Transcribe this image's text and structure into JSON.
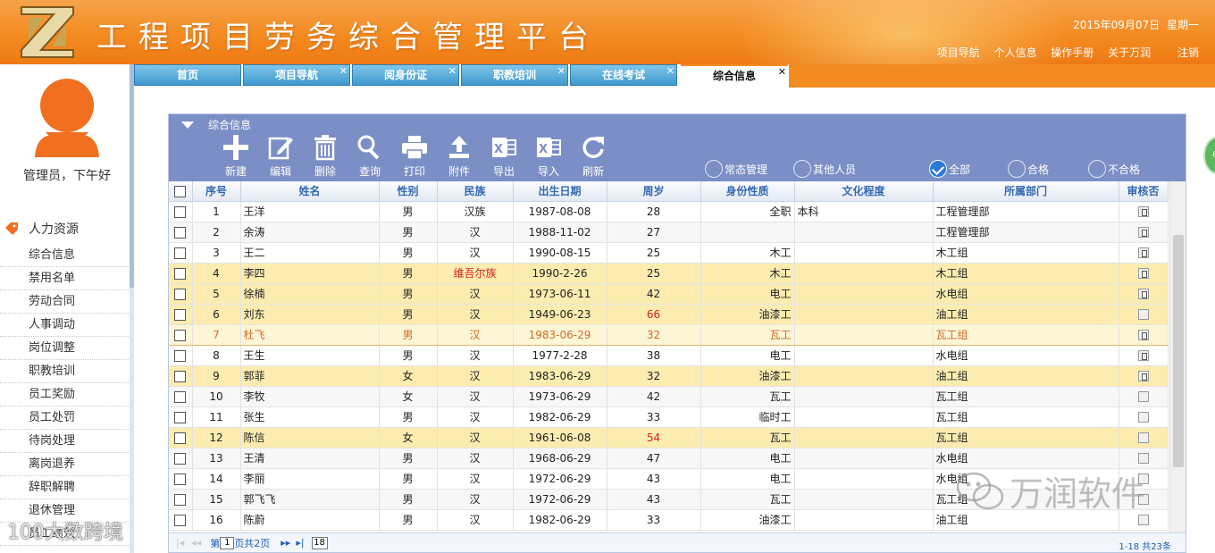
{
  "header": {
    "title": "工程项目劳务综合管理平台",
    "date": "2015年09月07日",
    "weekday": "星期一",
    "nav": [
      "项目导航",
      "个人信息",
      "操作手册",
      "关于万润"
    ],
    "logout": "注销"
  },
  "tabs": [
    {
      "label": "首页",
      "closable": false
    },
    {
      "label": "项目导航",
      "closable": true
    },
    {
      "label": "阅身份证",
      "closable": true
    },
    {
      "label": "职教培训",
      "closable": true
    },
    {
      "label": "在线考试",
      "closable": true
    },
    {
      "label": "综合信息",
      "closable": true,
      "active": true
    }
  ],
  "sidebar": {
    "greeting": "管理员，下午好",
    "section": "人力资源",
    "items": [
      "综合信息",
      "禁用名单",
      "劳动合同",
      "人事调动",
      "岗位调整",
      "职教培训",
      "员工奖励",
      "员工处罚",
      "待岗处理",
      "离岗退养",
      "辞职解聘",
      "退休管理",
      "员工绩效"
    ]
  },
  "edge_badge": "6",
  "panel": {
    "title": "综合信息",
    "toolbar": [
      "新建",
      "编辑",
      "删除",
      "查询",
      "打印",
      "附件",
      "导出",
      "导入",
      "刷新"
    ],
    "filters": [
      {
        "label": "常态管理",
        "checked": false
      },
      {
        "label": "其他人员",
        "checked": false
      },
      {
        "label": "全部",
        "checked": true
      },
      {
        "label": "合格",
        "checked": false
      },
      {
        "label": "不合格",
        "checked": false
      }
    ],
    "columns": [
      "序号",
      "姓名",
      "性别",
      "民族",
      "出生日期",
      "周岁",
      "身份性质",
      "文化程度",
      "所属部门",
      "审核否"
    ],
    "rows": [
      {
        "no": "1",
        "name": "王洋",
        "sex": "男",
        "nation": "汉族",
        "birth": "1987-08-08",
        "age": "28",
        "identity": "全职",
        "edu": "本科",
        "dept": "工程管理部",
        "audit": true,
        "style": "odd"
      },
      {
        "no": "2",
        "name": "余涛",
        "sex": "男",
        "nation": "汉",
        "birth": "1988-11-02",
        "age": "27",
        "identity": "",
        "edu": "",
        "dept": "工程管理部",
        "audit": true,
        "style": "even"
      },
      {
        "no": "3",
        "name": "王二",
        "sex": "男",
        "nation": "汉",
        "birth": "1990-08-15",
        "age": "25",
        "identity": "木工",
        "edu": "",
        "dept": "木工组",
        "audit": true,
        "style": "odd"
      },
      {
        "no": "4",
        "name": "李四",
        "sex": "男",
        "nation": "维吾尔族",
        "birth": "1990-2-26",
        "age": "25",
        "identity": "木工",
        "edu": "",
        "dept": "木工组",
        "audit": true,
        "style": "hl",
        "red_nation": true
      },
      {
        "no": "5",
        "name": "徐楠",
        "sex": "男",
        "nation": "汉",
        "birth": "1973-06-11",
        "age": "42",
        "identity": "电工",
        "edu": "",
        "dept": "水电组",
        "audit": true,
        "style": "hl"
      },
      {
        "no": "6",
        "name": "刘东",
        "sex": "男",
        "nation": "汉",
        "birth": "1949-06-23",
        "age": "66",
        "identity": "油漆工",
        "edu": "",
        "dept": "油工组",
        "audit": false,
        "style": "hl",
        "red_age": true
      },
      {
        "no": "7",
        "name": "杜飞",
        "sex": "男",
        "nation": "汉",
        "birth": "1983-06-29",
        "age": "32",
        "identity": "瓦工",
        "edu": "",
        "dept": "瓦工组",
        "audit": true,
        "style": "sel"
      },
      {
        "no": "8",
        "name": "王生",
        "sex": "男",
        "nation": "汉",
        "birth": "1977-2-28",
        "age": "38",
        "identity": "电工",
        "edu": "",
        "dept": "水电组",
        "audit": true,
        "style": "odd"
      },
      {
        "no": "9",
        "name": "郭菲",
        "sex": "女",
        "nation": "汉",
        "birth": "1983-06-29",
        "age": "32",
        "identity": "油漆工",
        "edu": "",
        "dept": "油工组",
        "audit": true,
        "style": "hl"
      },
      {
        "no": "10",
        "name": "李牧",
        "sex": "女",
        "nation": "汉",
        "birth": "1973-06-29",
        "age": "42",
        "identity": "瓦工",
        "edu": "",
        "dept": "瓦工组",
        "audit": false,
        "style": "even"
      },
      {
        "no": "11",
        "name": "张生",
        "sex": "男",
        "nation": "汉",
        "birth": "1982-06-29",
        "age": "33",
        "identity": "临时工",
        "edu": "",
        "dept": "瓦工组",
        "audit": false,
        "style": "odd"
      },
      {
        "no": "12",
        "name": "陈信",
        "sex": "女",
        "nation": "汉",
        "birth": "1961-06-08",
        "age": "54",
        "identity": "瓦工",
        "edu": "",
        "dept": "瓦工组",
        "audit": false,
        "style": "hl",
        "red_age": true
      },
      {
        "no": "13",
        "name": "王清",
        "sex": "男",
        "nation": "汉",
        "birth": "1968-06-29",
        "age": "47",
        "identity": "电工",
        "edu": "",
        "dept": "水电组",
        "audit": false,
        "style": "even"
      },
      {
        "no": "14",
        "name": "李丽",
        "sex": "男",
        "nation": "汉",
        "birth": "1972-06-29",
        "age": "43",
        "identity": "电工",
        "edu": "",
        "dept": "水电组",
        "audit": false,
        "style": "odd"
      },
      {
        "no": "15",
        "name": "郭飞飞",
        "sex": "男",
        "nation": "汉",
        "birth": "1972-06-29",
        "age": "43",
        "identity": "瓦工",
        "edu": "",
        "dept": "瓦工组",
        "audit": false,
        "style": "even"
      },
      {
        "no": "16",
        "name": "陈蔚",
        "sex": "男",
        "nation": "汉",
        "birth": "1982-06-29",
        "age": "33",
        "identity": "油漆工",
        "edu": "",
        "dept": "油工组",
        "audit": false,
        "style": "odd"
      }
    ],
    "pager": {
      "prefix": "第",
      "page": "1",
      "suffix": "页共2页",
      "page_size": "18",
      "summary": "1-18 共23条"
    }
  },
  "watermarks": {
    "left": "100大数跨境",
    "right": "万润软件"
  },
  "colors": {
    "header": "#f38b20",
    "tab": "#3d98cd",
    "panel_header": "#7b8fc6",
    "highlight_row": "#fcecb0",
    "warning_text": "#d42020"
  }
}
